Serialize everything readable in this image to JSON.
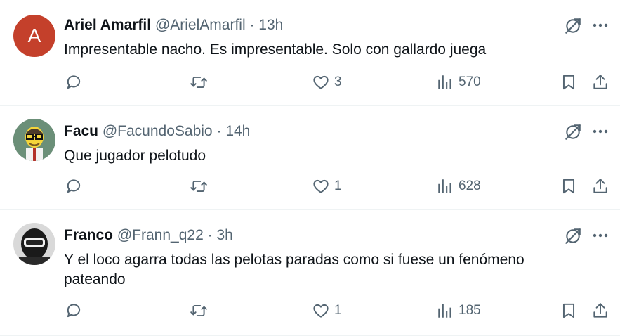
{
  "tweets": [
    {
      "avatar_letter": "A",
      "avatar_color": "#c4402b",
      "name": "Ariel Amarfil",
      "handle": "@ArielAmarfil",
      "sep": "·",
      "time": "13h",
      "text": "Impresentable nacho. Es impresentable. Solo con gallardo juega",
      "likes": "3",
      "views": "570"
    },
    {
      "avatar_desc": "cartoon-character-avatar",
      "name": "Facu",
      "handle": "@FacundoSabio",
      "sep": "·",
      "time": "14h",
      "text": "Que jugador pelotudo",
      "likes": "1",
      "views": "628"
    },
    {
      "avatar_desc": "dark-helmet-avatar",
      "name": "Franco",
      "handle": "@Frann_q22",
      "sep": "·",
      "time": "3h",
      "text": "Y el loco agarra todas las pelotas paradas como si fuese un fenómeno pateando",
      "likes": "1",
      "views": "185"
    }
  ],
  "icons": [
    "grok-icon",
    "more-icon",
    "reply-icon",
    "retweet-icon",
    "like-icon",
    "views-icon",
    "bookmark-icon",
    "share-icon"
  ],
  "colors": {
    "secondary_text": "#536471",
    "primary_text": "#0f1419",
    "divider": "#eff3f4"
  }
}
